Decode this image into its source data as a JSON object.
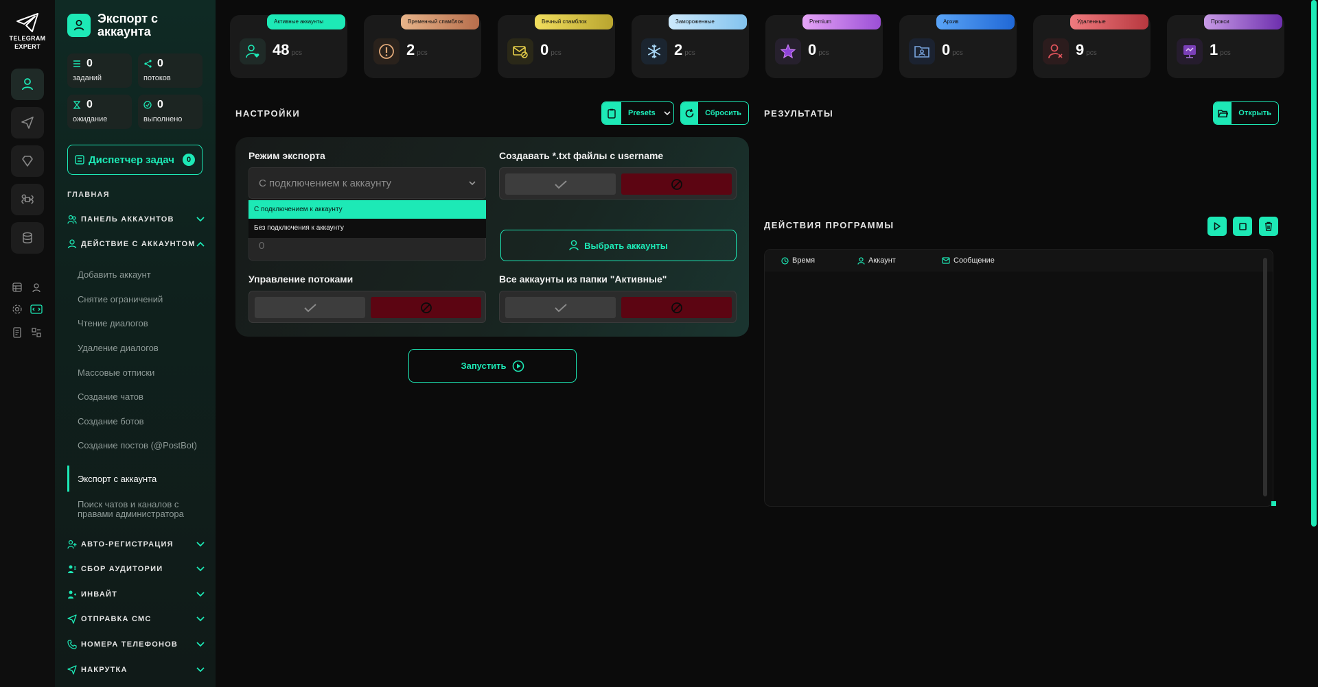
{
  "app": {
    "logo_line1": "TELEGRAM",
    "logo_line2": "EXPERT"
  },
  "sidebar": {
    "title": "Экспорт с аккаунта",
    "stats": [
      {
        "value": "0",
        "label": "заданий"
      },
      {
        "value": "0",
        "label": "потоков"
      },
      {
        "value": "0",
        "label": "ожидание"
      },
      {
        "value": "0",
        "label": "выполнено"
      }
    ],
    "task_manager": {
      "label": "Диспетчер задач",
      "count": "0"
    },
    "main_label": "ГЛАВНАЯ",
    "groups_top": [
      {
        "label": "ПАНЕЛЬ АККАУНТОВ"
      },
      {
        "label": "ДЕЙСТВИЕ С АККАУНТОМ"
      }
    ],
    "sub_items": [
      "Добавить аккаунт",
      "Снятие ограничений",
      "Чтение диалогов",
      "Удаление диалогов",
      "Массовые отписки",
      "Создание чатов",
      "Создание ботов",
      "Создание постов (@PostBot)",
      "Экспорт с аккаунта",
      "Поиск чатов и каналов с правами администратора"
    ],
    "groups_bottom": [
      {
        "label": "АВТО-РЕГИСТРАЦИЯ"
      },
      {
        "label": "СБОР АУДИТОРИИ"
      },
      {
        "label": "ИНВАЙТ"
      },
      {
        "label": "ОТПРАВКА СМС"
      },
      {
        "label": "НОМЕРА ТЕЛЕФОНОВ"
      },
      {
        "label": "НАКРУТКА"
      }
    ]
  },
  "cards": [
    {
      "label": "Активные аккаунты",
      "value": "48",
      "unit": "pcs",
      "color": "#1de9b6",
      "icon": "user-heart-icon"
    },
    {
      "label": "Временный спамблок",
      "value": "2",
      "unit": "pcs",
      "color": "#e0a878",
      "icon": "warning-icon"
    },
    {
      "label": "Вечный спамблок",
      "value": "0",
      "unit": "pcs",
      "color": "#e8d04a",
      "icon": "mail-block-icon"
    },
    {
      "label": "Замороженные",
      "value": "2",
      "unit": "pcs",
      "color": "#a9d8f7",
      "icon": "snowflake-icon"
    },
    {
      "label": "Premium",
      "value": "0",
      "unit": "pcs",
      "color": "#c77cf2",
      "icon": "star-icon"
    },
    {
      "label": "Архив",
      "value": "0",
      "unit": "pcs",
      "color": "#3b8bf0",
      "icon": "folder-user-icon"
    },
    {
      "label": "Удаленные",
      "value": "9",
      "unit": "pcs",
      "color": "#e2555c",
      "icon": "user-remove-icon"
    },
    {
      "label": "Прокси",
      "value": "1",
      "unit": "pcs",
      "color": "#9b4fd6",
      "icon": "proxy-icon"
    }
  ],
  "settings": {
    "header": "НАСТРОЙКИ",
    "presets_label": "Presets",
    "reset_label": "Сбросить",
    "export_mode_label": "Режим экспорта",
    "export_mode_value": "С подключением к аккаунту",
    "export_mode_options": [
      "С подключением к аккаунту",
      "Без подключения к аккаунту"
    ],
    "number_value": "0",
    "txt_label": "Создавать *.txt файлы с username",
    "select_accounts_label": "Выбрать аккаунты",
    "threads_label": "Управление потоками",
    "all_active_label": "Все аккаунты из папки \"Активные\"",
    "run_label": "Запустить"
  },
  "results": {
    "header": "РЕЗУЛЬТАТЫ",
    "open_label": "Открыть"
  },
  "actions": {
    "header": "ДЕЙСТВИЯ ПРОГРАММЫ",
    "columns": [
      "Время",
      "Аккаунт",
      "Сообщение"
    ]
  },
  "colors": {
    "accent": "#1de9b6",
    "danger": "#5c0512"
  }
}
